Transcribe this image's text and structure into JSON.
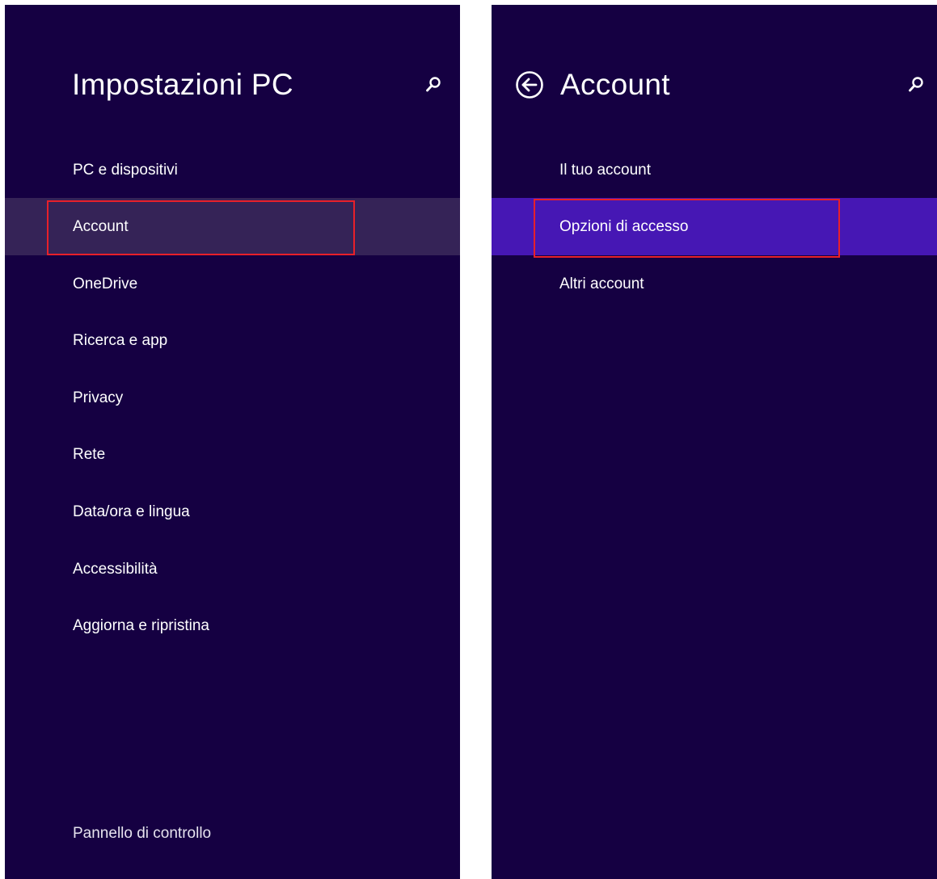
{
  "left_panel": {
    "title": "Impostazioni PC",
    "items": [
      {
        "label": "PC e dispositivi"
      },
      {
        "label": "Account"
      },
      {
        "label": "OneDrive"
      },
      {
        "label": "Ricerca e app"
      },
      {
        "label": "Privacy"
      },
      {
        "label": "Rete"
      },
      {
        "label": "Data/ora e lingua"
      },
      {
        "label": "Accessibilità"
      },
      {
        "label": "Aggiorna e ripristina"
      }
    ],
    "selected_index": 1,
    "footer_link": "Pannello di controllo"
  },
  "right_panel": {
    "title": "Account",
    "items": [
      {
        "label": "Il tuo account"
      },
      {
        "label": "Opzioni di accesso"
      },
      {
        "label": "Altri account"
      }
    ],
    "selected_index": 1
  },
  "icons": {
    "search": "search-icon",
    "back": "back-arrow-circle-icon"
  },
  "colors": {
    "background": "#150042",
    "left_selected": "#352357",
    "right_selected": "#4617b4",
    "highlight_border": "#e8202a"
  }
}
